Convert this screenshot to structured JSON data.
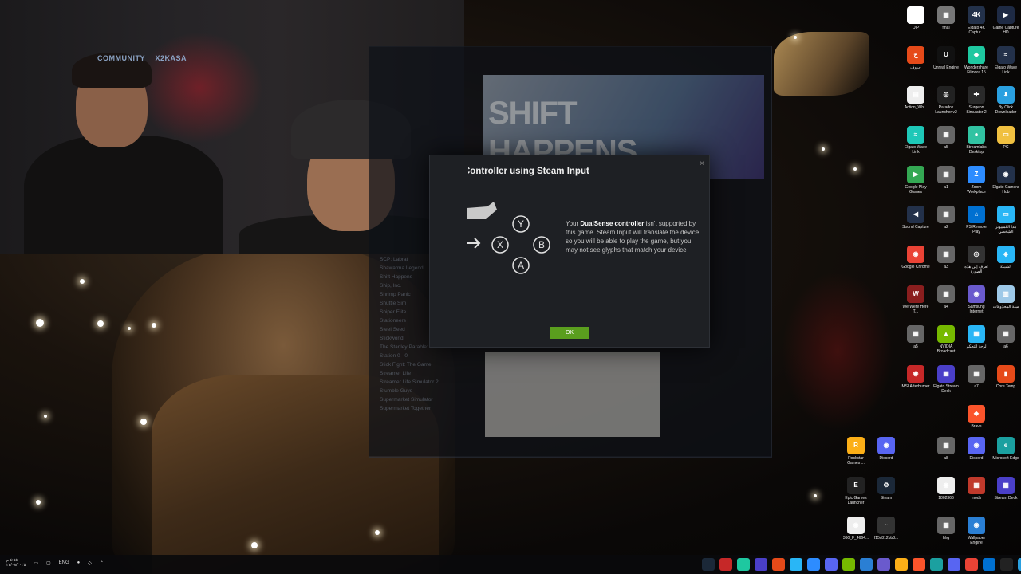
{
  "webcam": {},
  "steam_bg": {
    "topbar_items": [
      "COMMUNITY",
      "X2KASA"
    ],
    "banner_title_line1": "SHIFT",
    "banner_title_line2": "HAPPENS",
    "library_items": [
      "SCP: Labrat",
      "Shawarma Legend",
      "Shift Happens",
      "Ship, Inc.",
      "Shrimp Panic",
      "Shuttle Sim",
      "Sniper Elite",
      "Stationeers",
      "Steel Seed",
      "Stickworld",
      "The Stanley Parable: Ultra Deluxe",
      "Station 0 - 0",
      "Stick Fight: The Game",
      "Streamer Life",
      "Streamer Life Simulator 2",
      "Stumble Guys",
      "Supermarket Simulator",
      "Supermarket Together"
    ]
  },
  "dialog": {
    "title": "Controller using Steam Input",
    "close": "×",
    "text_before": "Your ",
    "text_bold": "DualSense controller",
    "text_after": " isn't supported by this game. Steam Input will translate the device so you will be able to play the game, but you may not see glyphs that match your device",
    "buttons": {
      "y": "Y",
      "x": "X",
      "b": "B",
      "a": "A"
    },
    "ok_label": "OK"
  },
  "desktop_icons": [
    {
      "label": "OIP",
      "color": "#ffffff",
      "glyph": "◉"
    },
    {
      "label": "final",
      "color": "#777777",
      "glyph": "▦"
    },
    {
      "label": "Elgato 4K Captur...",
      "color": "#23314a",
      "glyph": "4K"
    },
    {
      "label": "Game Capture HD",
      "color": "#1e2a44",
      "glyph": "▶"
    },
    {
      "label": "حروف",
      "color": "#e64a19",
      "glyph": "ح"
    },
    {
      "label": "Unreal Engine",
      "color": "#111111",
      "glyph": "U"
    },
    {
      "label": "Wondershare Filmora 15",
      "color": "#1ec8a0",
      "glyph": "◆"
    },
    {
      "label": "Elgato Wave Link",
      "color": "#23314a",
      "glyph": "≈"
    },
    {
      "label": "Action_Wh...",
      "color": "#eeeeee",
      "glyph": "▤"
    },
    {
      "label": "Paradox Launcher v2",
      "color": "#222222",
      "glyph": "◎"
    },
    {
      "label": "Surgeon Simulator 2",
      "color": "#2a2a2a",
      "glyph": "✚"
    },
    {
      "label": "By Click Downloader",
      "color": "#2aa0e0",
      "glyph": "⬇"
    },
    {
      "label": "Elgato Wave Link",
      "color": "#1ec8b8",
      "glyph": "≈"
    },
    {
      "label": "a5",
      "color": "#666666",
      "glyph": "▦"
    },
    {
      "label": "Streamlabs Desktop",
      "color": "#31c3a2",
      "glyph": "●"
    },
    {
      "label": "PC",
      "color": "#f0c040",
      "glyph": "▭"
    },
    {
      "label": "Google Play Games",
      "color": "#34a853",
      "glyph": "▶"
    },
    {
      "label": "a1",
      "color": "#666666",
      "glyph": "▦"
    },
    {
      "label": "Zoom Workplace",
      "color": "#2d8cff",
      "glyph": "Z"
    },
    {
      "label": "Elgato Camera Hub",
      "color": "#23314a",
      "glyph": "◉"
    },
    {
      "label": "Sound Capture",
      "color": "#23314a",
      "glyph": "◀"
    },
    {
      "label": "a2",
      "color": "#666666",
      "glyph": "▦"
    },
    {
      "label": "PS Remote Play",
      "color": "#0070d1",
      "glyph": "⌂"
    },
    {
      "label": "هذا الكمبيوتر الشخصي",
      "color": "#29b6f6",
      "glyph": "▭"
    },
    {
      "label": "Google Chrome",
      "color": "#ea4335",
      "glyph": "◉"
    },
    {
      "label": "a3",
      "color": "#666666",
      "glyph": "▦"
    },
    {
      "label": "تعرف إلى هذه الصورة",
      "color": "#333333",
      "glyph": "◎"
    },
    {
      "label": "الشبكة",
      "color": "#29b6f6",
      "glyph": "◈"
    },
    {
      "label": "We Were Here T...",
      "color": "#8a1e1e",
      "glyph": "W"
    },
    {
      "label": "a4",
      "color": "#666666",
      "glyph": "▦"
    },
    {
      "label": "Samsung Internet",
      "color": "#6a5acd",
      "glyph": "◉"
    },
    {
      "label": "سلة المحذوفات",
      "color": "#9ec9e8",
      "glyph": "▥"
    },
    {
      "label": "a5",
      "color": "#666666",
      "glyph": "▦"
    },
    {
      "label": "NVIDIA Broadcast",
      "color": "#76b900",
      "glyph": "▲"
    },
    {
      "label": "لوحة التحكم",
      "color": "#29b6f6",
      "glyph": "▦"
    },
    {
      "label": "a6",
      "color": "#666666",
      "glyph": "▦"
    },
    {
      "label": "MSI Afterburner",
      "color": "#c62828",
      "glyph": "◉"
    },
    {
      "label": "Elgato Stream Deck",
      "color": "#4a3fc8",
      "glyph": "▦"
    },
    {
      "label": "a7",
      "color": "#666666",
      "glyph": "▦"
    },
    {
      "label": "Core Temp",
      "color": "#e64a19",
      "glyph": "▮"
    },
    {
      "label": "Brave",
      "color": "#fb542b",
      "glyph": "◆"
    },
    {
      "label": "Rockstar Games ...",
      "color": "#fcaf17",
      "glyph": "R"
    },
    {
      "label": "Discord",
      "color": "#5865f2",
      "glyph": "◉"
    },
    {
      "label": "a8",
      "color": "#666666",
      "glyph": "▦"
    },
    {
      "label": "Discord",
      "color": "#5865f2",
      "glyph": "◉"
    },
    {
      "label": "Microsoft Edge",
      "color": "#1ba0a0",
      "glyph": "e"
    },
    {
      "label": "Epic Games Launcher",
      "color": "#222222",
      "glyph": "E"
    },
    {
      "label": "Steam",
      "color": "#1b2838",
      "glyph": "⚙"
    },
    {
      "label": "1802366",
      "color": "#eeeeee",
      "glyph": "◉"
    },
    {
      "label": "mods",
      "color": "#c0392b",
      "glyph": "▦"
    },
    {
      "label": "Stream Deck",
      "color": "#4a3fc8",
      "glyph": "▦"
    },
    {
      "label": "360_F_4664...",
      "color": "#eeeeee",
      "glyph": "◉"
    },
    {
      "label": "f15c812bb8...",
      "color": "#333333",
      "glyph": "~"
    },
    {
      "label": "hhg",
      "color": "#666666",
      "glyph": "▦"
    },
    {
      "label": "Wallpaper Engine",
      "color": "#2a7fd4",
      "glyph": "◉"
    }
  ],
  "taskbar": {
    "time": "٤:٥٥ م",
    "date": "٢٤/٠٨/٢٠٢٥",
    "lang": "ENG"
  }
}
